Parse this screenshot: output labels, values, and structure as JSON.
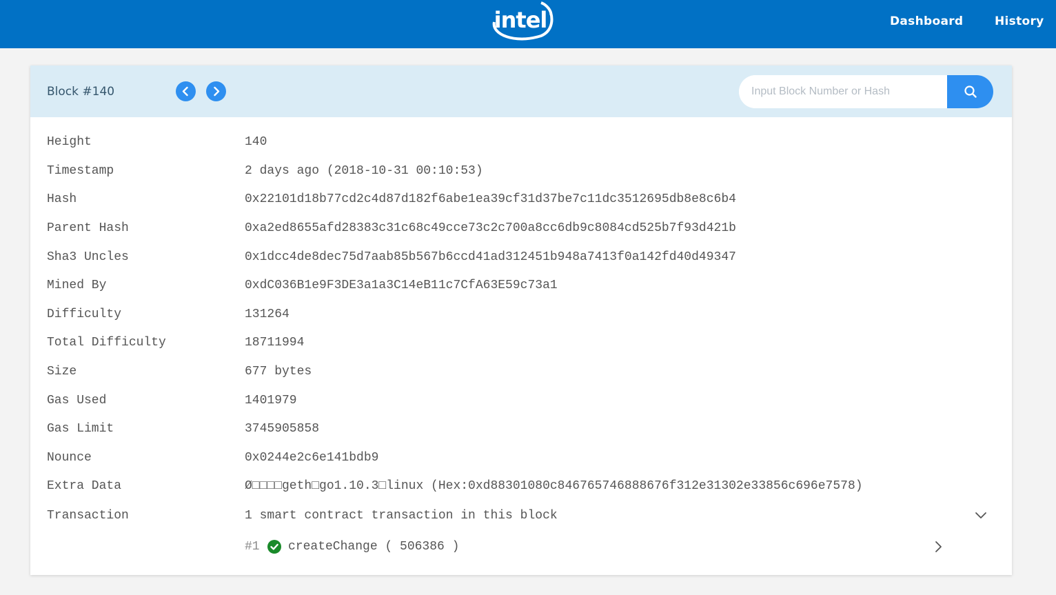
{
  "header": {
    "logo_text": "intel",
    "nav": [
      {
        "label": "Dashboard"
      },
      {
        "label": "History"
      }
    ]
  },
  "block": {
    "title": "Block #140",
    "search_placeholder": "Input Block Number or Hash",
    "fields": [
      {
        "label": "Height",
        "value": "140"
      },
      {
        "label": "Timestamp",
        "value": "2 days ago (2018-10-31 00:10:53)"
      },
      {
        "label": "Hash",
        "value": "0x22101d18b77cd2c4d87d182f6abe1ea39cf31d37be7c11dc3512695db8e8c6b4"
      },
      {
        "label": "Parent Hash",
        "value": "0xa2ed8655afd28383c31c68c49cce73c2c700a8cc6db9c8084cd525b7f93d421b"
      },
      {
        "label": "Sha3 Uncles",
        "value": "0x1dcc4de8dec75d7aab85b567b6ccd41ad312451b948a7413f0a142fd40d49347"
      },
      {
        "label": "Mined By",
        "value": "0xdC036B1e9F3DE3a1a3C14eB11c7CfA63E59c73a1"
      },
      {
        "label": "Difficulty",
        "value": "131264"
      },
      {
        "label": "Total Difficulty",
        "value": "18711994"
      },
      {
        "label": "Size",
        "value": "677 bytes"
      },
      {
        "label": "Gas Used",
        "value": "1401979"
      },
      {
        "label": "Gas Limit",
        "value": "3745905858"
      },
      {
        "label": "Nounce",
        "value": "0x0244e2c6e141bdb9"
      },
      {
        "label": "Extra Data",
        "value": "Ø□□□□geth□go1.10.3□linux (Hex:0xd88301080c846765746888676f312e31302e33856c696e7578)"
      },
      {
        "label": "Transaction",
        "value": "1 smart contract transaction in this block"
      }
    ],
    "transaction": {
      "index": "#1",
      "method": "createChange ( 506386 )"
    }
  },
  "colors": {
    "brand_blue": "#0171c5",
    "accent_blue": "#2e8ff0",
    "success_green": "#1a8a2a"
  },
  "icons": {
    "prev": "chevron-left-icon",
    "next": "chevron-right-icon",
    "search": "search-icon",
    "expand": "chevron-down-icon",
    "tx_status": "check-circle-icon",
    "tx_open": "chevron-right-icon"
  }
}
